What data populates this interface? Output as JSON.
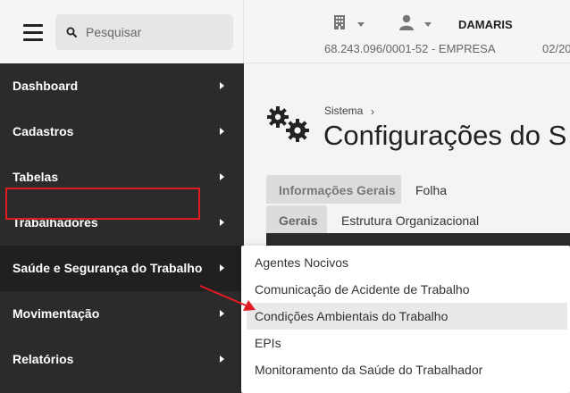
{
  "search": {
    "placeholder": "Pesquisar"
  },
  "header": {
    "user_name": "DAMARIS",
    "company_id": "68.243.096/0001-52 - EMPRESA",
    "date_partial": "02/20"
  },
  "sidebar": {
    "items": [
      {
        "label": "Dashboard"
      },
      {
        "label": "Cadastros"
      },
      {
        "label": "Tabelas"
      },
      {
        "label": "Trabalhadores"
      },
      {
        "label": "Saúde e Segurança do Trabalho"
      },
      {
        "label": "Movimentação"
      },
      {
        "label": "Relatórios"
      }
    ]
  },
  "page": {
    "breadcrumb": "Sistema",
    "breadcrumb_sep": "›",
    "title": "Configurações do S"
  },
  "tabs_primary": [
    {
      "label": "Informações Gerais"
    },
    {
      "label": "Folha"
    }
  ],
  "tabs_secondary": [
    {
      "label": "Gerais"
    },
    {
      "label": "Estrutura Organizacional"
    }
  ],
  "submenu": {
    "items": [
      {
        "label": "Agentes Nocivos"
      },
      {
        "label": "Comunicação de Acidente de Trabalho"
      },
      {
        "label": "Condições Ambientais do Trabalho"
      },
      {
        "label": "EPIs"
      },
      {
        "label": "Monitoramento da Saúde do Trabalhador"
      }
    ]
  },
  "colors": {
    "highlight": "#e11b22",
    "sidebar_bg": "#2b2b2b"
  }
}
